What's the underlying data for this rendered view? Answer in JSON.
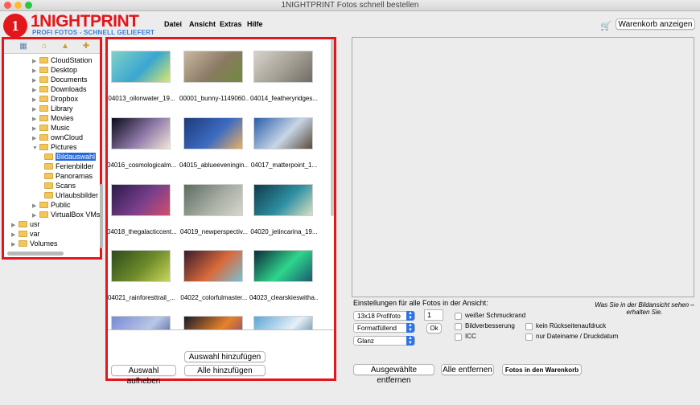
{
  "window": {
    "title": "1NIGHTPRINT Fotos schnell bestellen"
  },
  "brand": {
    "mark": "1",
    "name": "1NIGHTPRINT",
    "tagline": "PROFI FOTOS - SCHNELL GELIEFERT",
    "color_red": "#e3161b",
    "color_blue": "#3a7fd6"
  },
  "menu": {
    "items": [
      "Datei",
      "Ansicht",
      "Extras",
      "Hilfe"
    ]
  },
  "cart": {
    "icon": "cart-icon",
    "button_label": "Warenkorb anzeigen"
  },
  "toolbar": {
    "icons": [
      "computer-icon",
      "home-icon",
      "folder-up-icon",
      "new-folder-icon"
    ]
  },
  "tree": {
    "items": [
      {
        "label": "CloudStation",
        "level": 2
      },
      {
        "label": "Desktop",
        "level": 2
      },
      {
        "label": "Documents",
        "level": 2
      },
      {
        "label": "Downloads",
        "level": 2
      },
      {
        "label": "Dropbox",
        "level": 2
      },
      {
        "label": "Library",
        "level": 2
      },
      {
        "label": "Movies",
        "level": 2
      },
      {
        "label": "Music",
        "level": 2
      },
      {
        "label": "ownCloud",
        "level": 2
      },
      {
        "label": "Pictures",
        "level": 2,
        "expanded": true
      },
      {
        "label": "Bildauswahl",
        "level": 3,
        "selected": true
      },
      {
        "label": "Ferienbilder",
        "level": 3
      },
      {
        "label": "Panoramas",
        "level": 3
      },
      {
        "label": "Scans",
        "level": 3
      },
      {
        "label": "Urlaubsbilder",
        "level": 3
      },
      {
        "label": "Public",
        "level": 2
      },
      {
        "label": "VirtualBox VMs",
        "level": 2
      },
      {
        "label": "usr",
        "level": 0
      },
      {
        "label": "var",
        "level": 0
      },
      {
        "label": "Volumes",
        "level": 0
      }
    ]
  },
  "thumbnails": [
    {
      "label": "04013_oilonwater_19...",
      "colors": [
        "#7fd2c8",
        "#3aa6d0",
        "#d9e86a"
      ]
    },
    {
      "label": "00001_bunny-1149060...",
      "colors": [
        "#c9b8a0",
        "#8a7a63",
        "#6f8b3a"
      ]
    },
    {
      "label": "04014_featheryridges...",
      "colors": [
        "#d7d3cc",
        "#a39d93",
        "#6f6b66"
      ]
    },
    {
      "label": "04016_cosmologicalm...",
      "colors": [
        "#0b0b1a",
        "#8f7aa8",
        "#f2e6d9"
      ]
    },
    {
      "label": "04015_ablueeveningin...",
      "colors": [
        "#1d3b7a",
        "#3d6bc2",
        "#e9b060"
      ]
    },
    {
      "label": "04017_matterpoint_1...",
      "colors": [
        "#2a5ea8",
        "#c8d6e6",
        "#5a4a3a"
      ]
    },
    {
      "label": "04018_thegalacticcent...",
      "colors": [
        "#2b1a4a",
        "#7a3f8c",
        "#d64f6a"
      ]
    },
    {
      "label": "04019_newperspectiv...",
      "colors": [
        "#5b6b5f",
        "#a8aea4",
        "#d9d6cc"
      ]
    },
    {
      "label": "04020_jetincarina_19...",
      "colors": [
        "#0e3b4a",
        "#2e8fa3",
        "#d8e2c0"
      ]
    },
    {
      "label": "04021_rainforesttrail_...",
      "colors": [
        "#2e4a1e",
        "#6f8c2a",
        "#c9d65a"
      ]
    },
    {
      "label": "04022_colorfulmaster...",
      "colors": [
        "#3a1c2a",
        "#d86a3a",
        "#7ac0d8"
      ]
    },
    {
      "label": "04023_clearskieswitha...",
      "colors": [
        "#0c2a3a",
        "#2ed68c",
        "#1a5a6f"
      ]
    },
    {
      "label": "",
      "colors": [
        "#7a8ad6",
        "#b8c6e6",
        "#3a4a8a"
      ]
    },
    {
      "label": "",
      "colors": [
        "#1a1a2a",
        "#e6822a",
        "#6a3a8a"
      ]
    },
    {
      "label": "",
      "colors": [
        "#5aa6d6",
        "#e6f0f8",
        "#3a6a8a"
      ]
    }
  ],
  "center_buttons": {
    "deselect": "Auswahl aufheben",
    "add_selection": "Auswahl hinzufügen",
    "add_all": "Alle hinzufügen"
  },
  "settings": {
    "title": "Einstellungen für alle Fotos in der Ansicht:",
    "hint": "Was Sie in der Bildansicht sehen – erhalten Sie.",
    "format": "13x18 Profifoto",
    "fit": "Formatfüllend",
    "surface": "Glanz",
    "quantity": "1",
    "ok_label": "Ok",
    "checkboxes": {
      "white_border": "weißer Schmuckrand",
      "enhance": "Bildverbesserung",
      "icc": "ICC",
      "no_backprint": "kein Rückseitenaufdruck",
      "filename_date": "nur Dateiname / Druckdatum"
    }
  },
  "bottom_buttons": {
    "remove_selected": "Ausgewählte entfernen",
    "remove_all": "Alle entfernen",
    "to_cart": "Fotos in den Warenkorb"
  }
}
